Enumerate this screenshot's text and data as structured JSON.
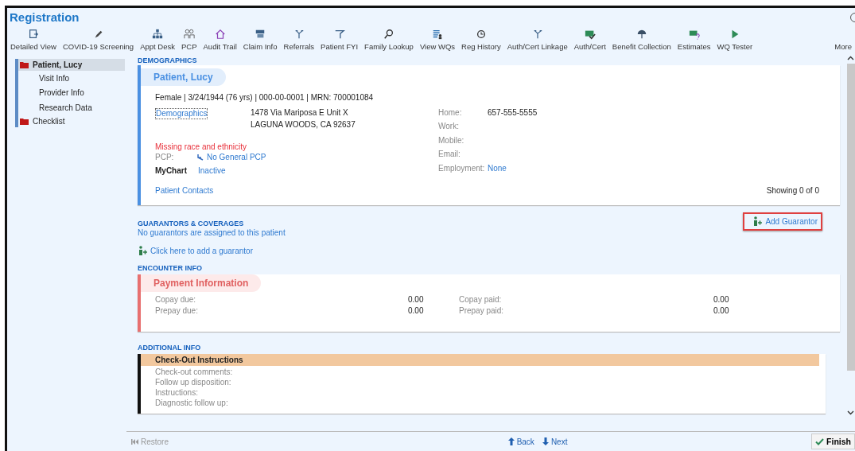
{
  "window": {
    "title": "Registration"
  },
  "toolbar": [
    {
      "label": "Detailed View"
    },
    {
      "label": "COVID-19 Screening"
    },
    {
      "label": "Appt Desk"
    },
    {
      "label": "PCP"
    },
    {
      "label": "Audit Trail"
    },
    {
      "label": "Claim Info"
    },
    {
      "label": "Referrals"
    },
    {
      "label": "Patient FYI"
    },
    {
      "label": "Family Lookup"
    },
    {
      "label": "View WQs"
    },
    {
      "label": "Reg History"
    },
    {
      "label": "Auth/Cert Linkage"
    },
    {
      "label": "Auth/Cert"
    },
    {
      "label": "Benefit Collection"
    },
    {
      "label": "Estimates"
    },
    {
      "label": "WQ Tester"
    }
  ],
  "more": "More",
  "sidebar": {
    "items": [
      {
        "label": "Patient, Lucy",
        "selected": true,
        "children": [
          {
            "label": "Visit Info",
            "selected": false
          },
          {
            "label": "Provider Info",
            "selected": false
          },
          {
            "label": "Research Data",
            "selected": false
          }
        ]
      },
      {
        "label": "Checklist",
        "selected": false
      }
    ]
  },
  "demographics": {
    "heading": "DEMOGRAPHICS",
    "name": "Patient, Lucy",
    "summary": "Female | 3/24/1944 (76 yrs) | 000-00-0001 | MRN: 700001084",
    "link": "Demographics",
    "address": [
      "1478 Via Mariposa E Unit X",
      "LAGUNA WOODS, CA 92637"
    ],
    "contacts": [
      {
        "label": "Home:",
        "value": "657-555-5555",
        "kind": "text"
      },
      {
        "label": "Work:"
      },
      {
        "label": "Mobile:"
      },
      {
        "label": "Email:"
      },
      {
        "label": "Employment:",
        "value": "None",
        "kind": "link"
      }
    ],
    "warning": "Missing race and ethnicity",
    "pcp_label": "PCP:",
    "pcp_value": "No General PCP",
    "mychart_label": "MyChart",
    "mychart_value": "Inactive",
    "contacts_link": "Patient Contacts",
    "showing": "Showing 0 of 0"
  },
  "guarantors": {
    "heading": "GUARANTORS & COVERAGES",
    "message": "No guarantors are assigned to this patient",
    "add_link": "Click here to add a guarantor",
    "add_button": "Add Guarantor"
  },
  "encounter": {
    "heading": "ENCOUNTER INFO",
    "title": "Payment Information",
    "rows": [
      [
        "Copay due:",
        "0.00",
        "Copay paid:",
        "0.00"
      ],
      [
        "Prepay due:",
        "0.00",
        "Prepay paid:",
        "0.00"
      ]
    ]
  },
  "additional": {
    "heading": "ADDITIONAL INFO",
    "title": "Check-Out Instructions",
    "fields": [
      "Check-out comments:",
      "Follow up disposition:",
      "Instructions:",
      "Diagnostic follow up:"
    ]
  },
  "footer": {
    "restore": "Restore",
    "back": "Back",
    "next": "Next",
    "finish": "Finish"
  }
}
